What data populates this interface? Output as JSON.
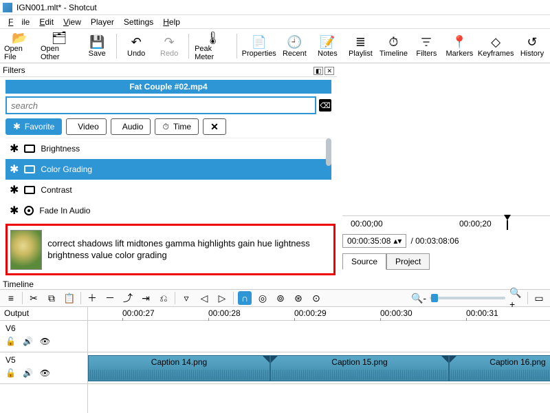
{
  "window": {
    "title": "IGN001.mlt* - Shotcut"
  },
  "menu": {
    "file": "File",
    "edit": "Edit",
    "view": "View",
    "player": "Player",
    "settings": "Settings",
    "help": "Help"
  },
  "toolbar": {
    "open_file": "Open File",
    "open_other": "Open Other",
    "save": "Save",
    "undo": "Undo",
    "redo": "Redo",
    "peak_meter": "Peak Meter",
    "properties": "Properties",
    "recent": "Recent",
    "notes": "Notes",
    "playlist": "Playlist",
    "timeline": "Timeline",
    "filters": "Filters",
    "markers": "Markers",
    "keyframes": "Keyframes",
    "history": "History"
  },
  "filters_panel": {
    "title": "Filters",
    "clip_name": "Fat Couple #02.mp4",
    "search_placeholder": "search",
    "cat_favorite": "Favorite",
    "cat_video": "Video",
    "cat_audio": "Audio",
    "cat_time": "Time",
    "items": [
      {
        "label": "Brightness",
        "type": "video"
      },
      {
        "label": "Color Grading",
        "type": "video"
      },
      {
        "label": "Contrast",
        "type": "video"
      },
      {
        "label": "Fade In Audio",
        "type": "audio"
      }
    ]
  },
  "callout": {
    "text": "correct shadows lift midtones gamma highlights gain hue lightness brightness value color grading"
  },
  "preview": {
    "ruler": {
      "t0": "00:00;00",
      "t1": "00:00;20"
    },
    "timecode": "00:00:35:08",
    "duration": "/ 00:03:08:06",
    "tab_source": "Source",
    "tab_project": "Project"
  },
  "timeline": {
    "label": "Timeline",
    "output": "Output",
    "ruler": [
      "00:00:27",
      "00:00:28",
      "00:00:29",
      "00:00:30",
      "00:00:31"
    ],
    "tracks": [
      {
        "name": "V6"
      },
      {
        "name": "V5"
      }
    ],
    "clips": [
      {
        "label": "Caption 14.png"
      },
      {
        "label": "Caption 15.png"
      },
      {
        "label": "Caption 16.png"
      }
    ]
  }
}
